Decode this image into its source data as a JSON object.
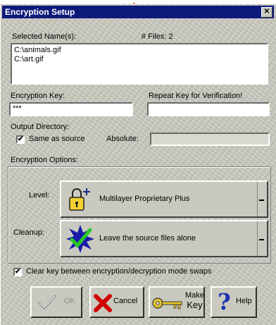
{
  "window": {
    "title": "Encryption Setup",
    "close_glyph": "✕"
  },
  "top_caption": "Encryption Setup",
  "selected_names": {
    "label": "Selected Name(s):",
    "files_count_label": "# Files:",
    "files_count": "2",
    "files": [
      "C:\\animals.gif",
      "C:\\art.gif"
    ]
  },
  "encryption_key": {
    "label": "Encryption Key:",
    "value": "***"
  },
  "repeat_key": {
    "label": "Repeat Key for Verification!",
    "value": ""
  },
  "output_directory": {
    "label": "Output Directory:",
    "same_as_source_label": "Same as source",
    "same_as_source_checked": true,
    "absolute_label": "Absolute:",
    "absolute_value": ""
  },
  "encryption_options": {
    "label": "Encryption Options:",
    "level_label": "Level:",
    "level_value": "Multilayer Proprietary Plus",
    "level_icon": "padlock-plus-icon",
    "cleanup_label": "Cleanup:",
    "cleanup_value": "Leave the source files alone",
    "cleanup_icon": "checkmark-burst-icon"
  },
  "clear_key": {
    "label": "Clear key between encryption/decryption mode swaps",
    "checked": true
  },
  "buttons": {
    "ok": "OK",
    "cancel": "Cancel",
    "make_key_line1": "Make",
    "make_key_line2": "Key",
    "help": "Help"
  },
  "colors": {
    "titlebar": "#0c1a7a",
    "dialog_face": "#c9c9bf",
    "caption_red": "#e00000",
    "cancel_x": "#d00000",
    "help_question": "#1a2fb0"
  }
}
